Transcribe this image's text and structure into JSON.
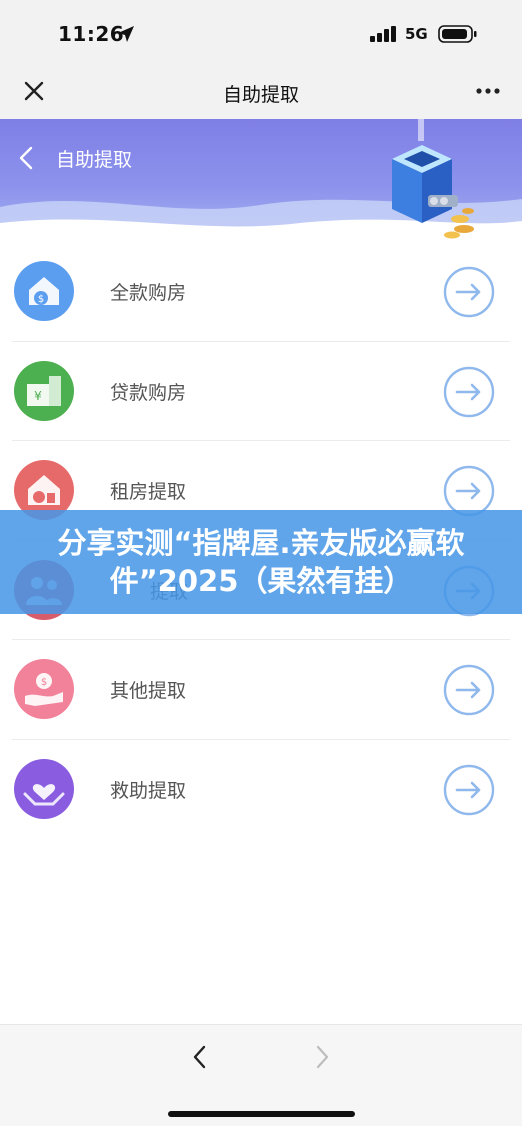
{
  "status": {
    "time": "11:26",
    "network": "5G",
    "icons": [
      "location-arrow-icon",
      "signal-bars-icon",
      "battery-icon"
    ]
  },
  "topbar": {
    "title": "自助提取",
    "icons": [
      "close-icon",
      "more-dots-icon"
    ]
  },
  "banner": {
    "title": "自助提取",
    "icons": [
      "back-chevron-icon",
      "cube-machine-illustration"
    ]
  },
  "menu": {
    "items": [
      {
        "label": "全款购房",
        "icon": "house-money-icon",
        "color": "#5b9ef0"
      },
      {
        "label": "贷款购房",
        "icon": "building-yen-icon",
        "color": "#4caf50"
      },
      {
        "label": "租房提取",
        "icon": "rent-house-icon",
        "color": "#e76a6a"
      },
      {
        "label": "提取",
        "icon": "people-icon",
        "color": "#d95c6a"
      },
      {
        "label": "其他提取",
        "icon": "hand-coin-icon",
        "color": "#f2829a"
      },
      {
        "label": "救助提取",
        "icon": "hands-heart-icon",
        "color": "#8a5ce0"
      }
    ],
    "arrow_icon": "arrow-circle-right-icon",
    "arrow_color": "#8fb8ec"
  },
  "overlay": {
    "text": "分享实测“指牌屋.亲友版必赢软件”2025（果然有挂）"
  },
  "bottom_nav": {
    "icons": [
      "back-chevron-icon",
      "forward-chevron-icon"
    ]
  }
}
